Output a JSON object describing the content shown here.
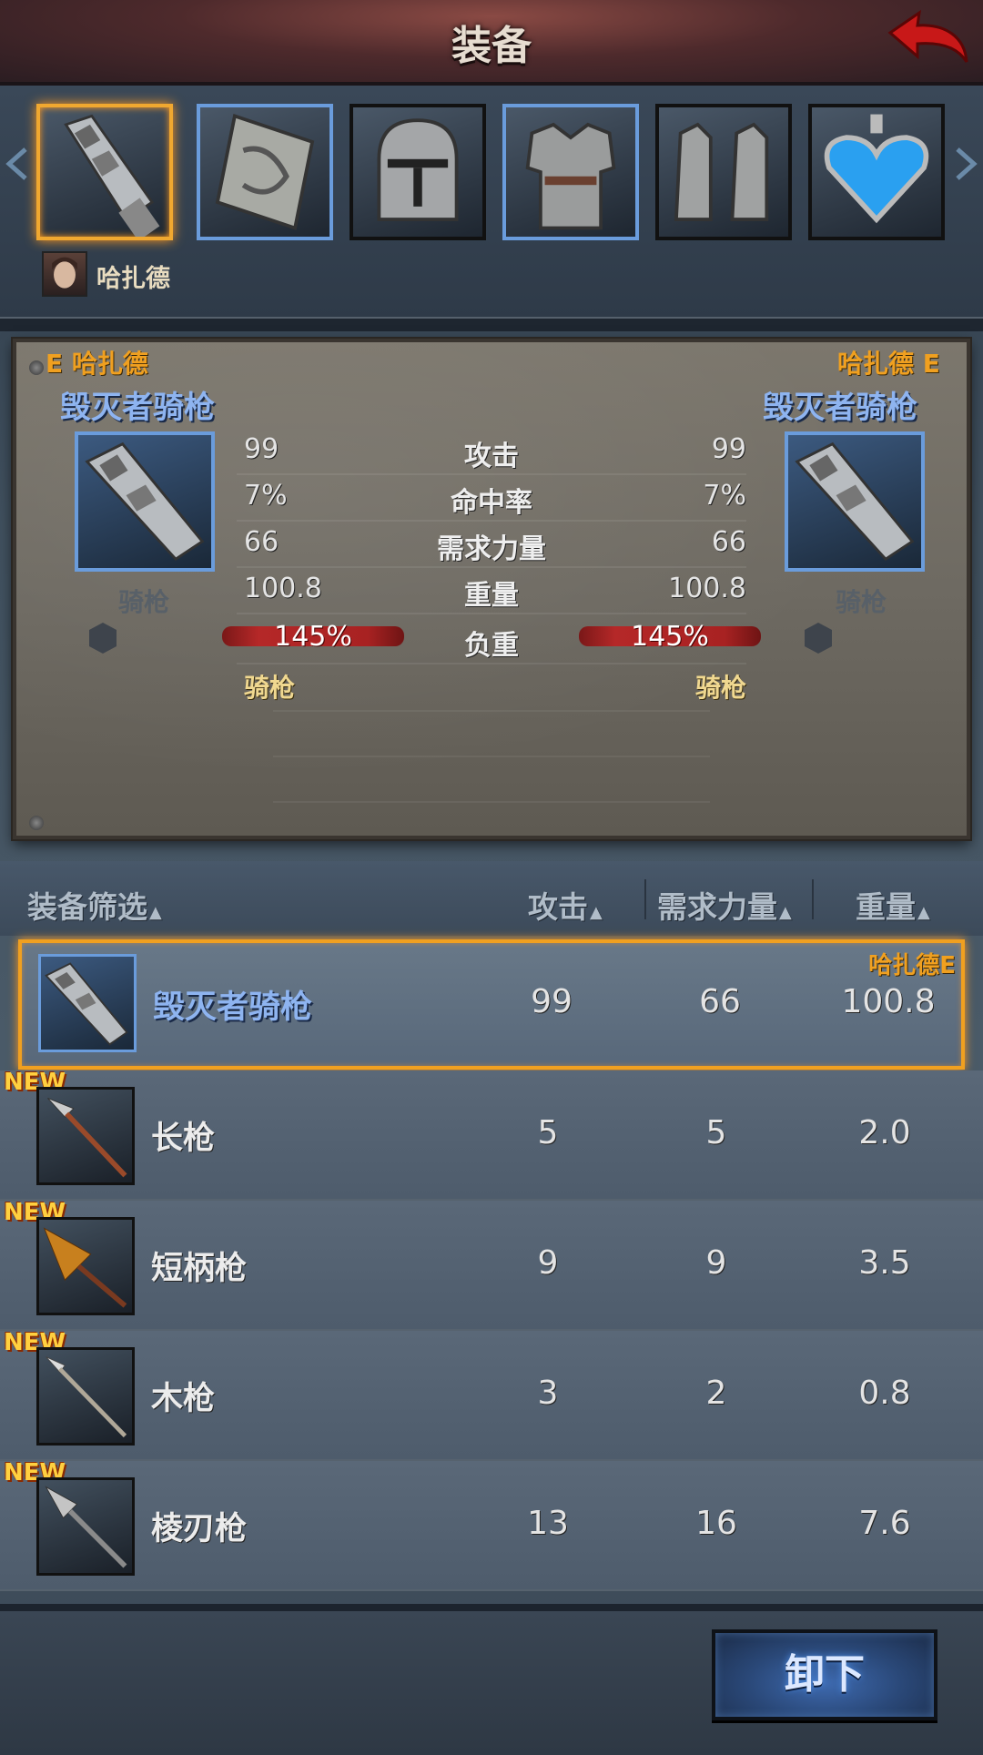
{
  "header": {
    "title": "装备"
  },
  "character": {
    "name": "哈扎德"
  },
  "slots": [
    {
      "item": "lance",
      "selected": true
    },
    {
      "item": "shield"
    },
    {
      "item": "helmet"
    },
    {
      "item": "armor"
    },
    {
      "item": "boots"
    },
    {
      "item": "amulet"
    }
  ],
  "compare": {
    "left": {
      "owner_tag": "E 哈扎德",
      "name": "毁灭者骑枪",
      "type": "骑枪"
    },
    "right": {
      "owner_tag": "哈扎德 E",
      "name": "毁灭者骑枪",
      "type": "骑枪"
    },
    "stats": [
      {
        "label": "攻击",
        "left": "99",
        "right": "99"
      },
      {
        "label": "命中率",
        "left": "7%",
        "right": "7%"
      },
      {
        "label": "需求力量",
        "left": "66",
        "right": "66"
      },
      {
        "label": "重量",
        "left": "100.8",
        "right": "100.8"
      },
      {
        "label": "负重",
        "left": "145%",
        "right": "145%"
      }
    ],
    "weapon_type_left": "骑枪",
    "weapon_type_right": "骑枪"
  },
  "filter": {
    "label": "装备筛选",
    "col_attack": "攻击",
    "col_strength": "需求力量",
    "col_weight": "重量",
    "sort_glyph": "▲"
  },
  "items": [
    {
      "name": "毁灭者骑枪",
      "attack": "99",
      "strength": "66",
      "weight": "100.8",
      "owner": "哈扎德E",
      "selected": true
    },
    {
      "name": "长枪",
      "attack": "5",
      "strength": "5",
      "weight": "2.0",
      "badge": "NEW"
    },
    {
      "name": "短柄枪",
      "attack": "9",
      "strength": "9",
      "weight": "3.5",
      "badge": "NEW"
    },
    {
      "name": "木枪",
      "attack": "3",
      "strength": "2",
      "weight": "0.8",
      "badge": "NEW"
    },
    {
      "name": "棱刃枪",
      "attack": "13",
      "strength": "16",
      "weight": "7.6",
      "badge": "NEW"
    }
  ],
  "actions": {
    "unequip": "卸下"
  },
  "colors": {
    "accent_orange": "#f0a020",
    "name_blue": "#8eb4f0",
    "slot_blue": "#6a9cdc"
  }
}
